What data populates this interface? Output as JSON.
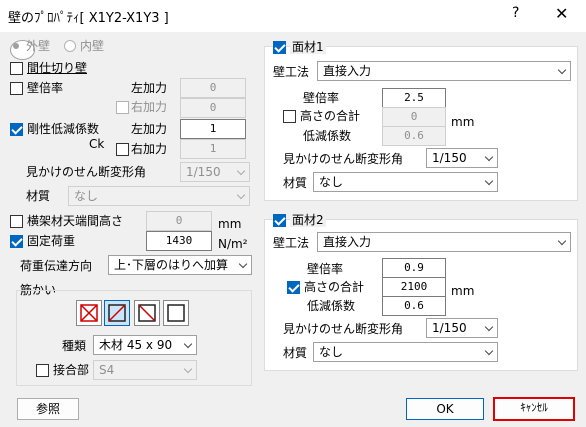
{
  "window": {
    "title": "壁のﾌﾟﾛﾊﾟﾃｨ[ X1Y2-X1Y3 ]",
    "help": "?",
    "close": "✕"
  },
  "left": {
    "outer_wall": "外壁",
    "inner_wall": "内壁",
    "partition": "間仕切り壁",
    "wall_ratio": "壁倍率",
    "left_add1": "左加力",
    "right_add1": "右加力",
    "left_val1": "0",
    "right_val1": "0",
    "rigidity": "剛性低減係数",
    "ck": "Ck",
    "left_add2": "左加力",
    "right_add2": "右加力",
    "left_val2": "1",
    "right_val2": "1",
    "shear_angle": "見かけのせん断変形角",
    "shear_value": "1/150",
    "material": "材質",
    "material_value": "なし",
    "frame_height": "横架材天端間高さ",
    "frame_height_value": "0",
    "mm": "mm",
    "fixed_load": "固定荷重",
    "fixed_load_value": "1430",
    "unit_nm2": "N/m²",
    "load_transfer": "荷重伝達方向",
    "load_transfer_value": "上･下層のはりへ加算",
    "bracing": "筋かい",
    "kind": "種類",
    "kind_value": "木材 45 x 90",
    "joint": "接合部",
    "joint_value": "S4"
  },
  "panel1": {
    "header": "面材1",
    "method": "壁工法",
    "method_value": "直接入力",
    "ratio": "壁倍率",
    "ratio_value": "2.5",
    "height_sum": "高さの合計",
    "height_sum_value": "0",
    "mm": "mm",
    "reduction": "低減係数",
    "reduction_value": "0.6",
    "shear_angle": "見かけのせん断変形角",
    "shear_value": "1/150",
    "material": "材質",
    "material_value": "なし"
  },
  "panel2": {
    "header": "面材2",
    "method": "壁工法",
    "method_value": "直接入力",
    "ratio": "壁倍率",
    "ratio_value": "0.9",
    "height_sum": "高さの合計",
    "height_sum_value": "2100",
    "mm": "mm",
    "reduction": "低減係数",
    "reduction_value": "0.6",
    "shear_angle": "見かけのせん断変形角",
    "shear_value": "1/150",
    "material": "材質",
    "material_value": "なし"
  },
  "buttons": {
    "ref": "参照",
    "ok": "OK",
    "cancel": "ｷｬﾝｾﾙ"
  },
  "colors": {
    "accent": "#0067c0",
    "highlight": "#e00000",
    "brace_red": "#d00000"
  }
}
